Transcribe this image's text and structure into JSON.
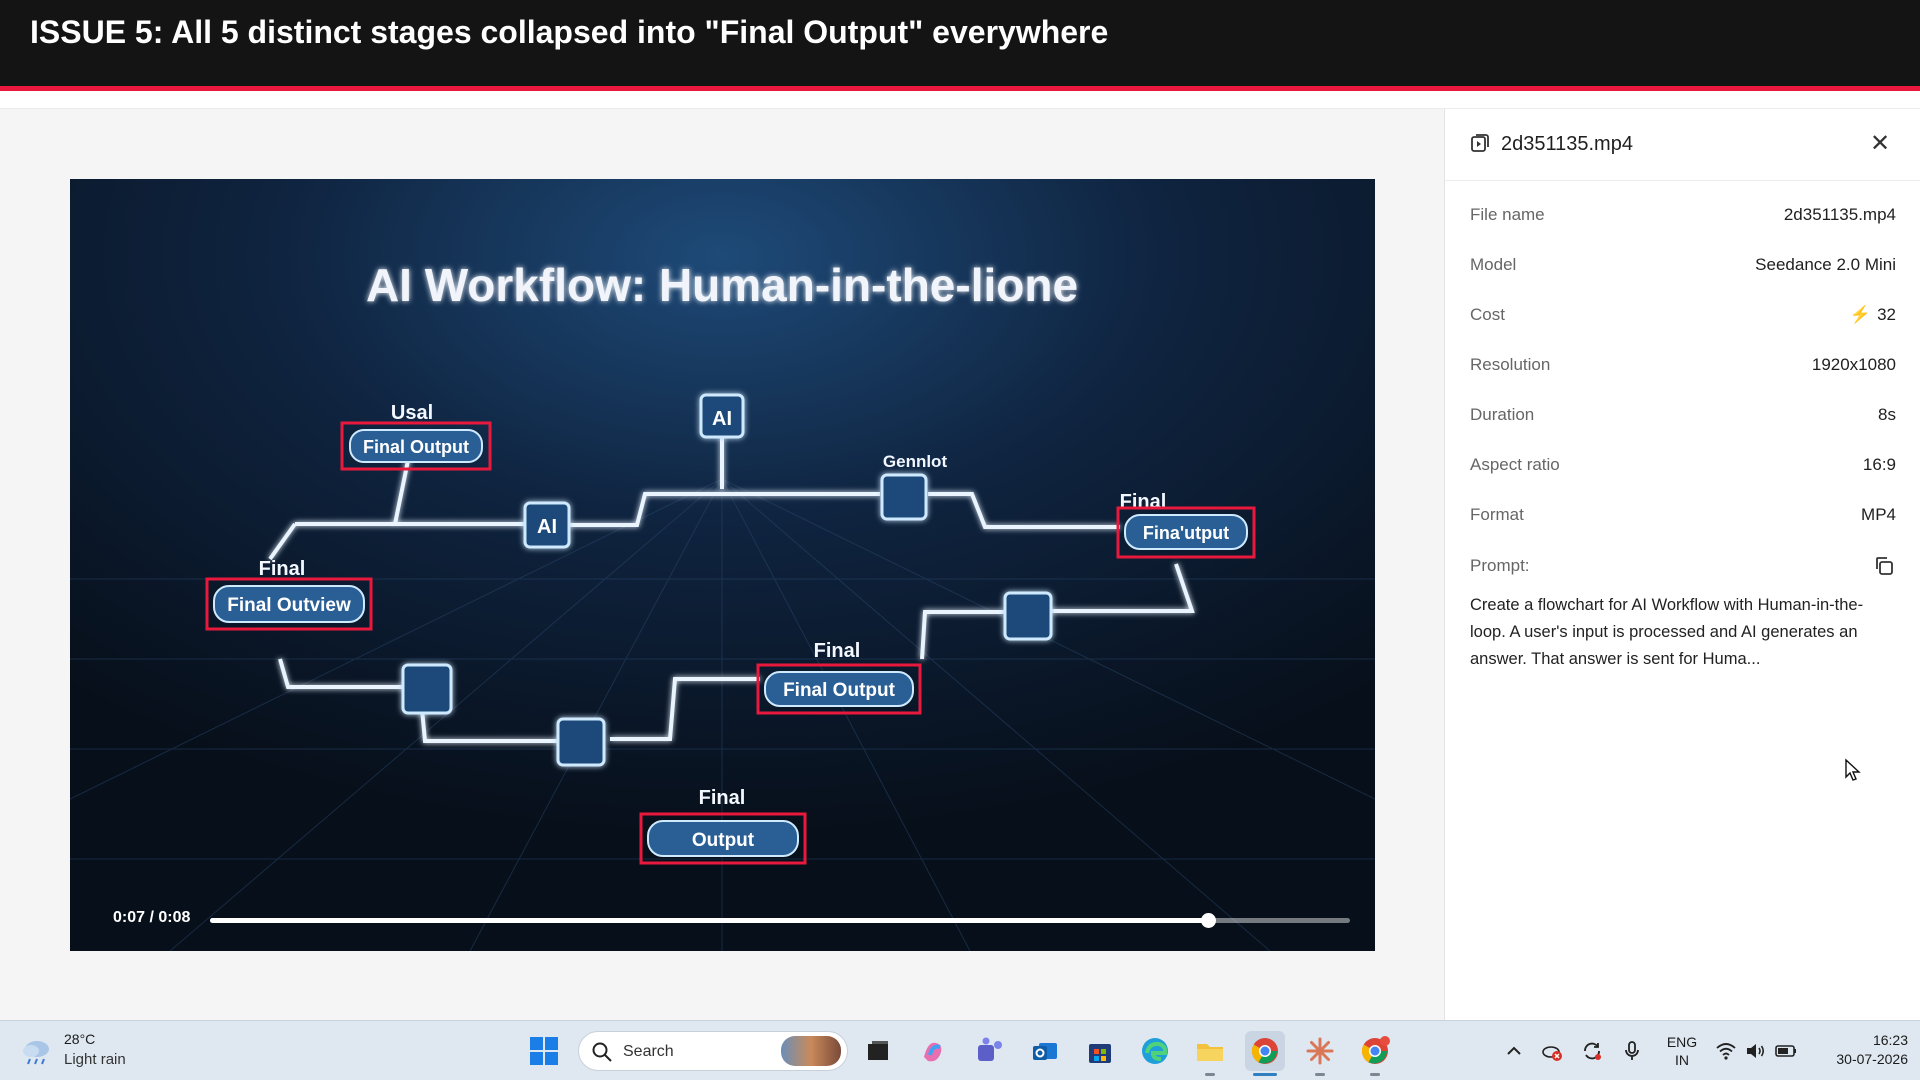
{
  "banner": {
    "title": "ISSUE 5: All 5 distinct stages collapsed into \"Final Output\" everywhere"
  },
  "video": {
    "headline": "AI Workflow: Human-in-the-lione",
    "labels": {
      "top_ai": "AI",
      "mid_ai": "AI",
      "usal": "Usal",
      "gennlot": "Gennlot",
      "final_right": "Final",
      "final_left": "Final",
      "final_center": "Final",
      "final_bottom": "Final"
    },
    "boxes": {
      "box1": "Final Output",
      "box2": "Final Outview",
      "box3": "Final Output",
      "box4": "Fina'utput",
      "box5": "Output"
    },
    "highlight_color": "#e8193c",
    "player": {
      "current_time": "0:07",
      "total_time": "0:08",
      "timecode": "0:07 / 0:08",
      "progress": 0.875
    }
  },
  "panel": {
    "title": "2d351135.mp4",
    "file_icon": "video-file-icon",
    "close_icon": "close-icon",
    "rows": [
      {
        "key": "File name",
        "value": "2d351135.mp4"
      },
      {
        "key": "Model",
        "value": "Seedance 2.0 Mini"
      },
      {
        "key": "Cost",
        "value": "32",
        "icon": "lightning-bolt-icon",
        "icon_color": "#f5b324"
      },
      {
        "key": "Resolution",
        "value": "1920x1080"
      },
      {
        "key": "Duration",
        "value": "8s"
      },
      {
        "key": "Aspect ratio",
        "value": "16:9"
      },
      {
        "key": "Format",
        "value": "MP4"
      }
    ],
    "prompt_label": "Prompt:",
    "prompt_text": "Create a flowchart for AI Workflow with Human-in-the-loop. A user's input is processed and AI generates an answer. That answer is sent for Huma..."
  },
  "taskbar": {
    "weather": {
      "temp": "28°C",
      "condition": "Light rain",
      "icon": "cloud-rain-icon"
    },
    "search_label": "Search",
    "apps": [
      "windows-start-icon",
      "task-view-icon",
      "copilot-icon",
      "teams-icon",
      "outlook-icon",
      "store-icon",
      "edge-icon",
      "file-explorer-icon",
      "chrome-icon",
      "claude-icon",
      "chrome-profile-icon"
    ],
    "tray": {
      "lang_top": "ENG",
      "lang_bottom": "IN",
      "time": "16:23",
      "date": "30-07-2026"
    }
  }
}
